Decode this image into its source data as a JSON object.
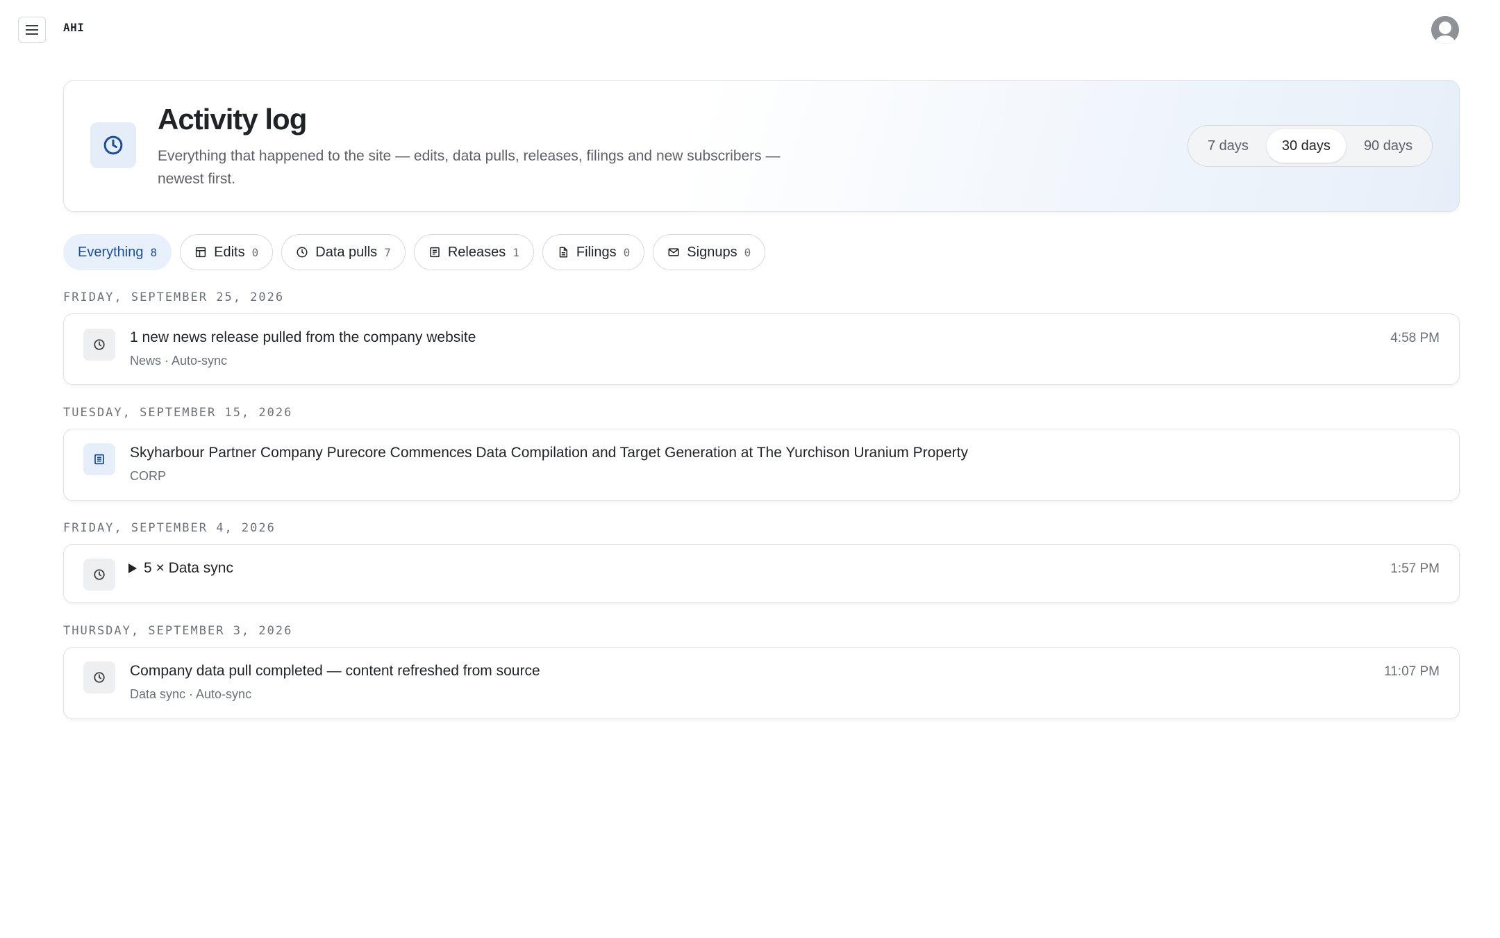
{
  "app": {
    "brand": "AHI"
  },
  "header": {
    "title": "Activity log",
    "description": "Everything that happened to the site — edits, data pulls, releases, filings and new subscribers — newest first.",
    "ranges": [
      "7 days",
      "30 days",
      "90 days"
    ],
    "active_range": "30 days"
  },
  "filters": [
    {
      "label": "Everything",
      "count": "8",
      "icon": "none",
      "active": true
    },
    {
      "label": "Edits",
      "count": "0",
      "icon": "table-icon"
    },
    {
      "label": "Data pulls",
      "count": "7",
      "icon": "clock-icon"
    },
    {
      "label": "Releases",
      "count": "1",
      "icon": "article-icon"
    },
    {
      "label": "Filings",
      "count": "0",
      "icon": "document-icon"
    },
    {
      "label": "Signups",
      "count": "0",
      "icon": "mail-icon"
    }
  ],
  "groups": [
    {
      "date": "Friday, September 25, 2026",
      "entry": {
        "icon": "clock-icon",
        "title": "1 new news release pulled from the company website",
        "meta": "News · Auto-sync",
        "time": "4:58 PM"
      }
    },
    {
      "date": "Tuesday, September 15, 2026",
      "entry": {
        "icon": "article-icon",
        "title": "Skyharbour Partner Company Purecore Commences Data Compilation and Target Generation at The Yurchison Uranium Property",
        "meta": "CORP",
        "time": ""
      }
    },
    {
      "date": "Friday, September 4, 2026",
      "entry": {
        "icon": "clock-icon",
        "title": "5 × Data sync",
        "meta": "",
        "time": "1:57 PM"
      }
    },
    {
      "date": "Thursday, September 3, 2026",
      "entry": {
        "icon": "clock-icon",
        "title": "Company data pull completed — content refreshed from source",
        "meta": "Data sync · Auto-sync",
        "time": "11:07 PM"
      }
    }
  ],
  "colors": {
    "accent": "#1b4f9b",
    "accent_bg": "#e8f0fb",
    "muted_text": "#6b7079",
    "border": "#dfe2e6"
  }
}
